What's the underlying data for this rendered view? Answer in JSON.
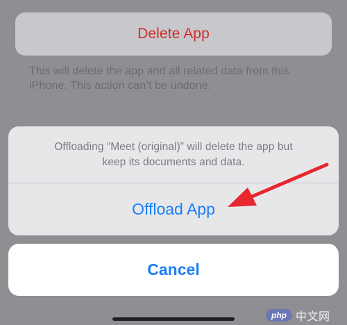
{
  "delete_section": {
    "button_label": "Delete App",
    "note": "This will delete the app and all related data from this iPhone. This action can’t be undone."
  },
  "action_sheet": {
    "message_line1": "Offloading “Meet (original)” will delete the app but",
    "message_line2": "keep its documents and data.",
    "offload_label": "Offload App",
    "cancel_label": "Cancel"
  },
  "annotation": {
    "arrow_icon": "red-arrow-icon",
    "color": "#e8262d"
  },
  "watermark": {
    "logo_text": "php",
    "site_text": "中文网"
  },
  "colors": {
    "background_dim": "#8f8f93",
    "delete_red": "#cc2e28",
    "action_blue": "#1a7ff6",
    "sheet_background": "#e7e7ea"
  }
}
